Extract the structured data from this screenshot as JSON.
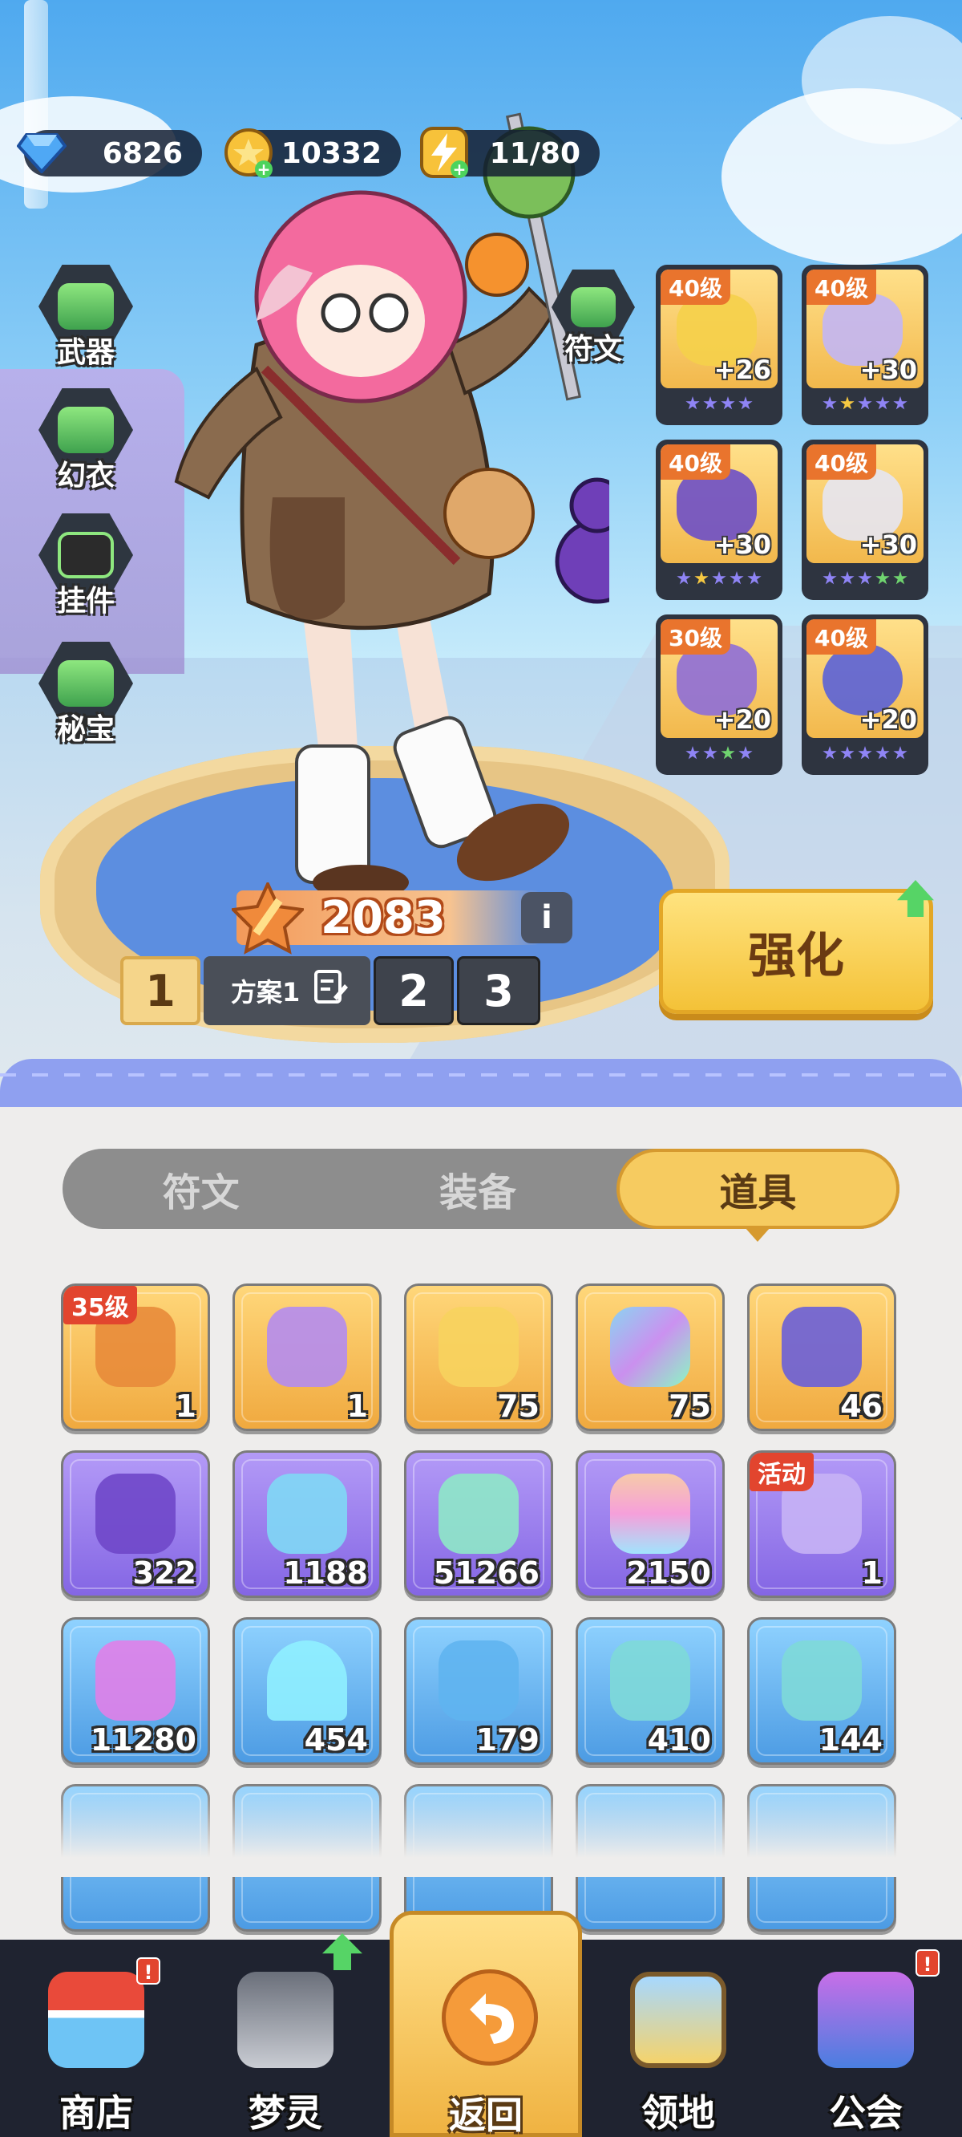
{
  "currency": {
    "gems": "6826",
    "coins": "10332",
    "energy": "11/80"
  },
  "side_menu": [
    {
      "label": "武器",
      "icon": "weapon-icon"
    },
    {
      "label": "幻衣",
      "icon": "outfit-icon"
    },
    {
      "label": "挂件",
      "icon": "pendant-icon"
    },
    {
      "label": "秘宝",
      "icon": "treasure-icon"
    }
  ],
  "rune_button": {
    "label": "符文",
    "icon": "rune-icon"
  },
  "equipment": [
    {
      "level": "40级",
      "plus": "+26",
      "icon": "helmet-icon"
    },
    {
      "level": "40级",
      "plus": "+30",
      "icon": "armor-icon"
    },
    {
      "level": "40级",
      "plus": "+30",
      "icon": "bracer-icon"
    },
    {
      "level": "40级",
      "plus": "+30",
      "icon": "pants-icon"
    },
    {
      "level": "30级",
      "plus": "+20",
      "icon": "boots-icon"
    },
    {
      "level": "40级",
      "plus": "+20",
      "icon": "eye-orb-icon"
    }
  ],
  "power": {
    "value": "2083",
    "icon": "sword-icon",
    "info_label": "i"
  },
  "schemes": {
    "slot1": "1",
    "name": "方案1",
    "slot2": "2",
    "slot3": "3"
  },
  "enhance_button": {
    "label": "强化"
  },
  "tabs": [
    {
      "label": "符文",
      "active": false
    },
    {
      "label": "装备",
      "active": false
    },
    {
      "label": "道具",
      "active": true
    }
  ],
  "items": [
    {
      "count": "1",
      "badge": "35级",
      "icon": "chest-icon",
      "tone": "gold"
    },
    {
      "count": "1",
      "badge": "",
      "icon": "puzzle-icon",
      "tone": "gold"
    },
    {
      "count": "75",
      "badge": "",
      "icon": "star-key-icon",
      "tone": "gold"
    },
    {
      "count": "75",
      "badge": "",
      "icon": "crystal-cube-icon",
      "tone": "gold"
    },
    {
      "count": "46",
      "badge": "",
      "icon": "ticket-icon",
      "tone": "gold"
    },
    {
      "count": "322",
      "badge": "",
      "icon": "purple-key-icon",
      "tone": "purple"
    },
    {
      "count": "1188",
      "badge": "",
      "icon": "spirit-jar-icon",
      "tone": "purple"
    },
    {
      "count": "51266",
      "badge": "",
      "icon": "green-gem-icon",
      "tone": "purple"
    },
    {
      "count": "2150",
      "badge": "",
      "icon": "rainbow-bottle-icon",
      "tone": "purple"
    },
    {
      "count": "1",
      "badge": "活动",
      "icon": "lotus-icon",
      "tone": "purple"
    },
    {
      "count": "11280",
      "badge": "",
      "icon": "pink-stone-icon",
      "tone": "blue"
    },
    {
      "count": "454",
      "badge": "",
      "icon": "blue-sand-icon",
      "tone": "blue"
    },
    {
      "count": "179",
      "badge": "",
      "icon": "blue-crystal-icon",
      "tone": "blue"
    },
    {
      "count": "410",
      "badge": "",
      "icon": "helmet-blueprint-icon",
      "tone": "blue"
    },
    {
      "count": "144",
      "badge": "",
      "icon": "armor-blueprint-icon",
      "tone": "blue"
    }
  ],
  "bottom_nav": [
    {
      "label": "商店",
      "icon": "shop-icon",
      "alert": "!"
    },
    {
      "label": "梦灵",
      "icon": "dream-spirit-icon",
      "alert": ""
    },
    {
      "label": "返回",
      "icon": "back-arrow-icon",
      "alert": ""
    },
    {
      "label": "领地",
      "icon": "territory-icon",
      "alert": ""
    },
    {
      "label": "公会",
      "icon": "guild-icon",
      "alert": "!"
    }
  ],
  "colors": {
    "accent_gold": "#f6cb60",
    "panel_bg": "#eeedec",
    "nav_bg": "#1f2330",
    "badge_red": "#e2452e",
    "upgrade_green": "#56d466"
  }
}
